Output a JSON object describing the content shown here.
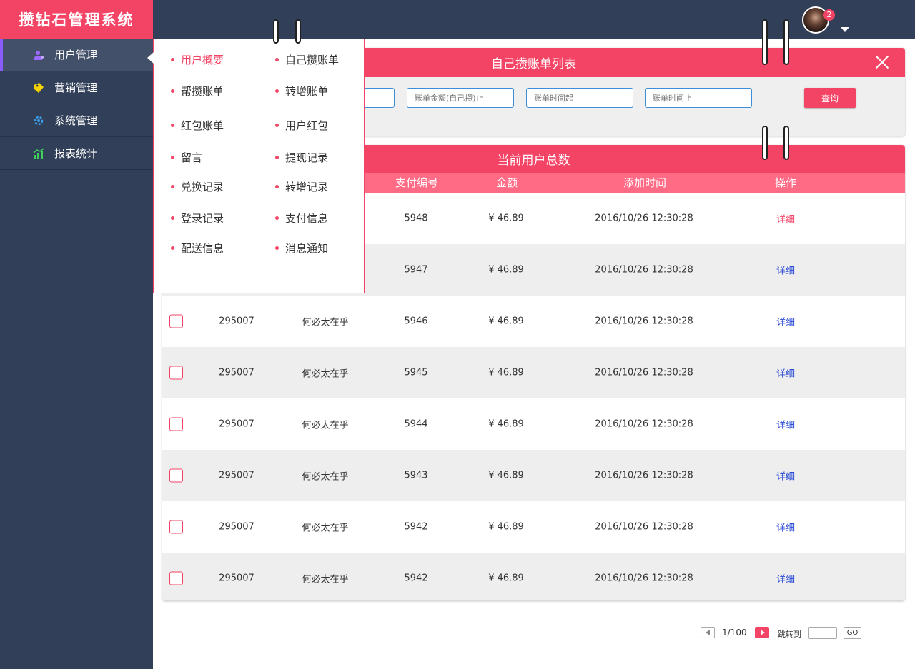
{
  "app": {
    "title": "攒钻石管理系统"
  },
  "header": {
    "notification_count": "2"
  },
  "sidebar": {
    "items": [
      {
        "label": "用户管理",
        "icon": "users-icon",
        "color": "#9b6bff"
      },
      {
        "label": "营销管理",
        "icon": "tag-icon",
        "color": "#f5d300"
      },
      {
        "label": "系统管理",
        "icon": "gear-icon",
        "color": "#3b9de8"
      },
      {
        "label": "报表统计",
        "icon": "bar-chart-icon",
        "color": "#3fcf5a"
      }
    ]
  },
  "dropdown": {
    "items": [
      {
        "label": "用户概要"
      },
      {
        "label": "自己攒账单"
      },
      {
        "label": "帮攒账单"
      },
      {
        "label": "转增账单"
      },
      {
        "label": "红包账单"
      },
      {
        "label": "用户红包"
      },
      {
        "label": "留言"
      },
      {
        "label": "提现记录"
      },
      {
        "label": "兑换记录"
      },
      {
        "label": "转增记录"
      },
      {
        "label": "登录记录"
      },
      {
        "label": "支付信息"
      },
      {
        "label": "配送信息"
      },
      {
        "label": "消息通知"
      }
    ]
  },
  "search_panel": {
    "title": "自己攒账单列表",
    "placeholders": [
      "账单金额(自己攒)止",
      "账单时间起",
      "账单时间止"
    ],
    "query_label": "查询"
  },
  "table_panel": {
    "title": "当前用户总数",
    "columns": [
      "支付编号",
      "金额",
      "添加时间",
      "操作"
    ],
    "rows": [
      {
        "user_id": "",
        "name": "",
        "pay_no": "5948",
        "amount": "¥ 46.89",
        "time": "2016/10/26  12:30:28",
        "action": "详细"
      },
      {
        "user_id": "",
        "name": "",
        "pay_no": "5947",
        "amount": "¥ 46.89",
        "time": "2016/10/26  12:30:28",
        "action": "详细"
      },
      {
        "user_id": "295007",
        "name": "何必太在乎",
        "pay_no": "5946",
        "amount": "¥ 46.89",
        "time": "2016/10/26  12:30:28",
        "action": "详细"
      },
      {
        "user_id": "295007",
        "name": "何必太在乎",
        "pay_no": "5945",
        "amount": "¥ 46.89",
        "time": "2016/10/26  12:30:28",
        "action": "详细"
      },
      {
        "user_id": "295007",
        "name": "何必太在乎",
        "pay_no": "5944",
        "amount": "¥ 46.89",
        "time": "2016/10/26  12:30:28",
        "action": "详细"
      },
      {
        "user_id": "295007",
        "name": "何必太在乎",
        "pay_no": "5943",
        "amount": "¥ 46.89",
        "time": "2016/10/26  12:30:28",
        "action": "详细"
      },
      {
        "user_id": "295007",
        "name": "何必太在乎",
        "pay_no": "5942",
        "amount": "¥ 46.89",
        "time": "2016/10/26  12:30:28",
        "action": "详细"
      },
      {
        "user_id": "295007",
        "name": "何必太在乎",
        "pay_no": "5942",
        "amount": "¥ 46.89",
        "time": "2016/10/26  12:30:28",
        "action": "详细"
      }
    ]
  },
  "pagination": {
    "page_info": "1/100",
    "jump_label": "跳转到",
    "go_label": "GO"
  },
  "colors": {
    "accent": "#f44466",
    "sidebar_bg": "#313f58",
    "link": "#2a4bd6"
  }
}
